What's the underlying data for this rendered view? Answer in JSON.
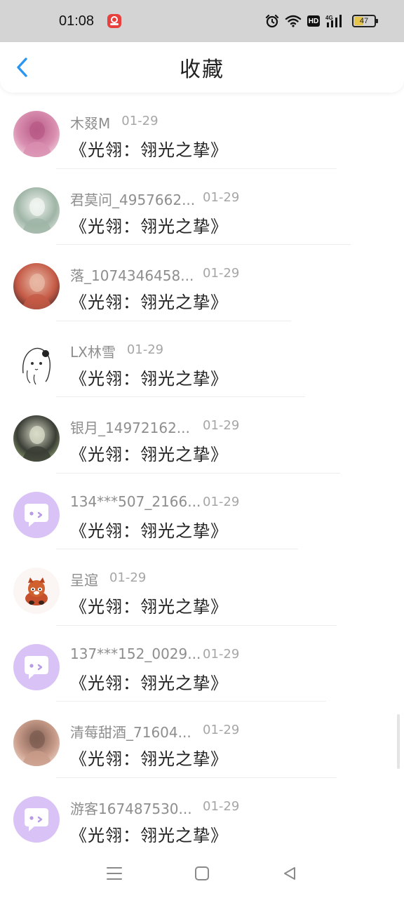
{
  "status_bar": {
    "time": "01:08",
    "battery_level": "47",
    "battery_fraction": 0.47,
    "icons": [
      "app-notification-icon",
      "alarm-icon",
      "wifi-icon",
      "hd-icon",
      "signal-4g-icon",
      "battery-icon"
    ],
    "hd_label": "HD"
  },
  "header": {
    "title": "收藏",
    "back_icon": "chevron-left-icon"
  },
  "colors": {
    "accent": "#2a96f0",
    "default_avatar_bg": "#d9c2f5",
    "name_text": "#8e8e8e",
    "date_text": "#a6a6a6",
    "title_text": "#222222"
  },
  "items": [
    {
      "name": "木叕M",
      "date": "01-29",
      "title": "《光翎：翎光之挚》",
      "avatar": "photo"
    },
    {
      "name": "君莫问_4957662...",
      "date": "01-29",
      "title": "《光翎：翎光之挚》",
      "avatar": "photo"
    },
    {
      "name": "落_1074346458...",
      "date": "01-29",
      "title": "《光翎：翎光之挚》",
      "avatar": "photo"
    },
    {
      "name": "LX林雪",
      "date": "01-29",
      "title": "《光翎：翎光之挚》",
      "avatar": "sketch"
    },
    {
      "name": "银月_14972162...",
      "date": "01-29",
      "title": "《光翎：翎光之挚》",
      "avatar": "photo"
    },
    {
      "name": "134***507_2166...",
      "date": "01-29",
      "title": "《光翎：翎光之挚》",
      "avatar": "default"
    },
    {
      "name": "呈逭",
      "date": "01-29",
      "title": "《光翎：翎光之挚》",
      "avatar": "red-panda"
    },
    {
      "name": "137***152_0029...",
      "date": "01-29",
      "title": "《光翎：翎光之挚》",
      "avatar": "default"
    },
    {
      "name": "清莓甜酒_71604...",
      "date": "01-29",
      "title": "《光翎：翎光之挚》",
      "avatar": "photo"
    },
    {
      "name": "游客167487530...",
      "date": "01-29",
      "title": "《光翎：翎光之挚》",
      "avatar": "default"
    }
  ],
  "nav_bar": {
    "icons": [
      "menu-icon",
      "home-icon",
      "back-triangle-icon"
    ]
  }
}
